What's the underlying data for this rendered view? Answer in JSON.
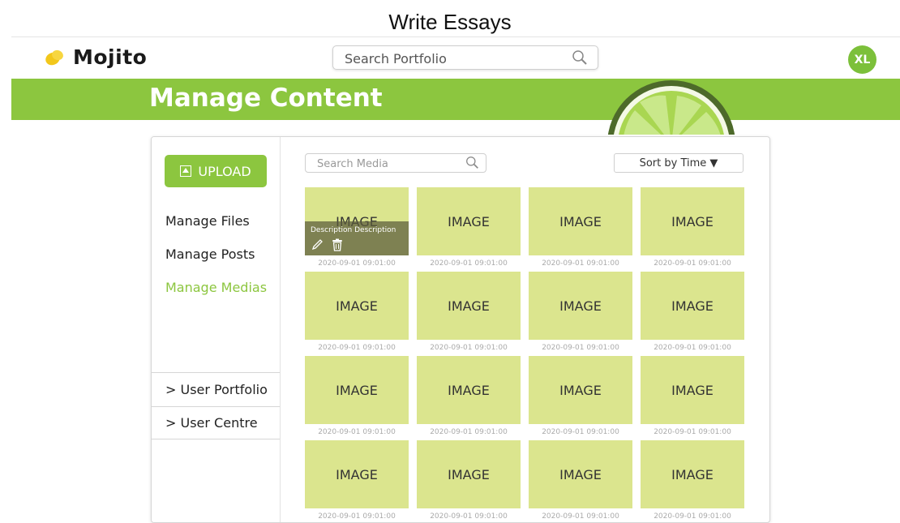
{
  "caption": "Write Essays",
  "header": {
    "logo_text": "Mojito",
    "search_placeholder": "Search Portfolio",
    "avatar_initials": "XL"
  },
  "banner": {
    "title": "Manage Content"
  },
  "sidebar": {
    "upload_label": "UPLOAD",
    "nav": [
      {
        "label": "Manage Files"
      },
      {
        "label": "Manage Posts"
      },
      {
        "label": "Manage Medias",
        "active": true
      }
    ],
    "sections": [
      {
        "label": "> User Portfolio"
      },
      {
        "label": "> User Centre"
      }
    ]
  },
  "media": {
    "search_placeholder": "Search Media",
    "sort_label": "Sort by Time ▼",
    "hover_description": "Description Description",
    "items": [
      {
        "label": "IMAGE",
        "date": "2020-09-01 09:01:00"
      },
      {
        "label": "IMAGE",
        "date": "2020-09-01 09:01:00"
      },
      {
        "label": "IMAGE",
        "date": "2020-09-01 09:01:00"
      },
      {
        "label": "IMAGE",
        "date": "2020-09-01 09:01:00"
      },
      {
        "label": "IMAGE",
        "date": "2020-09-01 09:01:00"
      },
      {
        "label": "IMAGE",
        "date": "2020-09-01 09:01:00"
      },
      {
        "label": "IMAGE",
        "date": "2020-09-01 09:01:00"
      },
      {
        "label": "IMAGE",
        "date": "2020-09-01 09:01:00"
      },
      {
        "label": "IMAGE",
        "date": "2020-09-01 09:01:00"
      },
      {
        "label": "IMAGE",
        "date": "2020-09-01 09:01:00"
      },
      {
        "label": "IMAGE",
        "date": "2020-09-01 09:01:00"
      },
      {
        "label": "IMAGE",
        "date": "2020-09-01 09:01:00"
      },
      {
        "label": "IMAGE",
        "date": "2020-09-01 09:01:00"
      },
      {
        "label": "IMAGE",
        "date": "2020-09-01 09:01:00"
      },
      {
        "label": "IMAGE",
        "date": "2020-09-01 09:01:00"
      },
      {
        "label": "IMAGE",
        "date": "2020-09-01 09:01:00"
      }
    ]
  },
  "colors": {
    "brand_green": "#8cc63f",
    "thumbnail": "#dbe58e",
    "lemon": "#f2c71b"
  }
}
